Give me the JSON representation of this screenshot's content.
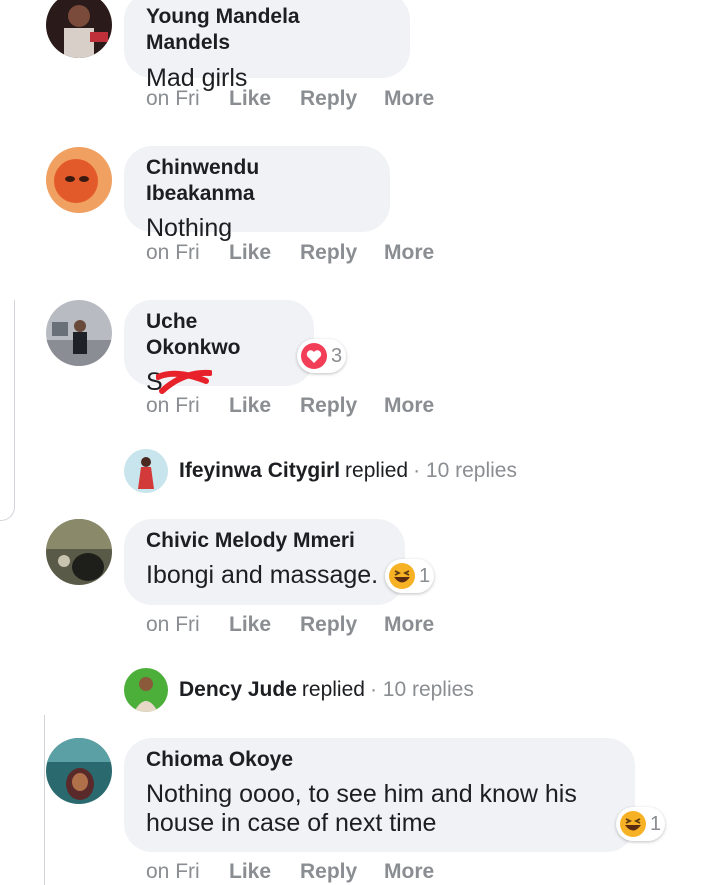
{
  "comments": [
    {
      "name": "Young Mandela Mandels",
      "text": "Mad girls",
      "time": "on Fri",
      "actions": {
        "like": "Like",
        "reply": "Reply",
        "more": "More"
      }
    },
    {
      "name": "Chinwendu Ibeakanma",
      "text": "Nothing",
      "time": "on Fri",
      "actions": {
        "like": "Like",
        "reply": "Reply",
        "more": "More"
      }
    },
    {
      "name": "Uche Okonkwo",
      "text": "S",
      "time": "on Fri",
      "reaction": {
        "icon": "heart-reaction-icon",
        "count": "3",
        "color": "#f33e58"
      },
      "actions": {
        "like": "Like",
        "reply": "Reply",
        "more": "More"
      }
    },
    {
      "name": "Chivic Melody Mmeri",
      "text": "Ibongi and massage.",
      "time": "on Fri",
      "reaction": {
        "icon": "haha-reaction-icon",
        "count": "1",
        "color": "#f7b125"
      },
      "actions": {
        "like": "Like",
        "reply": "Reply",
        "more": "More"
      }
    },
    {
      "name": "Chioma Okoye",
      "text_line1": "Nothing oooo, to see him and know his",
      "text_line2": "house in case of next time",
      "time": "on Fri",
      "reaction": {
        "icon": "haha-reaction-icon",
        "count": "1",
        "color": "#f7b125"
      },
      "actions": {
        "like": "Like",
        "reply": "Reply",
        "more": "More"
      }
    }
  ],
  "replies": [
    {
      "name": "Ifeyinwa Citygirl",
      "verb": "replied",
      "count": "· 10 replies"
    },
    {
      "name": "Dency Jude",
      "verb": "replied",
      "count": "· 10 replies"
    }
  ],
  "colors": {
    "bubble": "#f0f2f5",
    "muted": "#8a8d91",
    "text": "#1c1e21"
  }
}
